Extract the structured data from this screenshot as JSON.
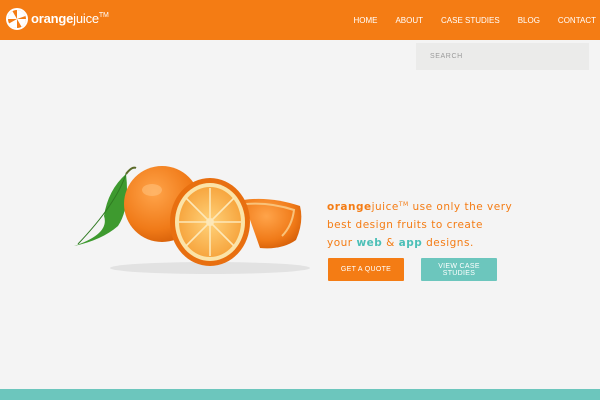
{
  "brand": {
    "name_bold": "orange",
    "name_light": "juice",
    "trademark": "TM"
  },
  "nav": {
    "items": [
      "HOME",
      "ABOUT",
      "CASE STUDIES",
      "BLOG",
      "CONTACT"
    ]
  },
  "search": {
    "placeholder": "SEARCH"
  },
  "hero": {
    "brand_bold": "orange",
    "brand_light": "juice",
    "trademark": "TM",
    "line1_rest": " use only the very",
    "line2": "best design fruits to create",
    "line3_prefix": "your ",
    "web": "web",
    "amp": " & ",
    "app": "app",
    "line3_suffix": " designs."
  },
  "buttons": {
    "quote": "GET A QUOTE",
    "case_studies": "VIEW CASE STUDIES"
  },
  "colors": {
    "accent": "#f47c14",
    "teal": "#6cc6bd",
    "background": "#f4f4f4"
  }
}
